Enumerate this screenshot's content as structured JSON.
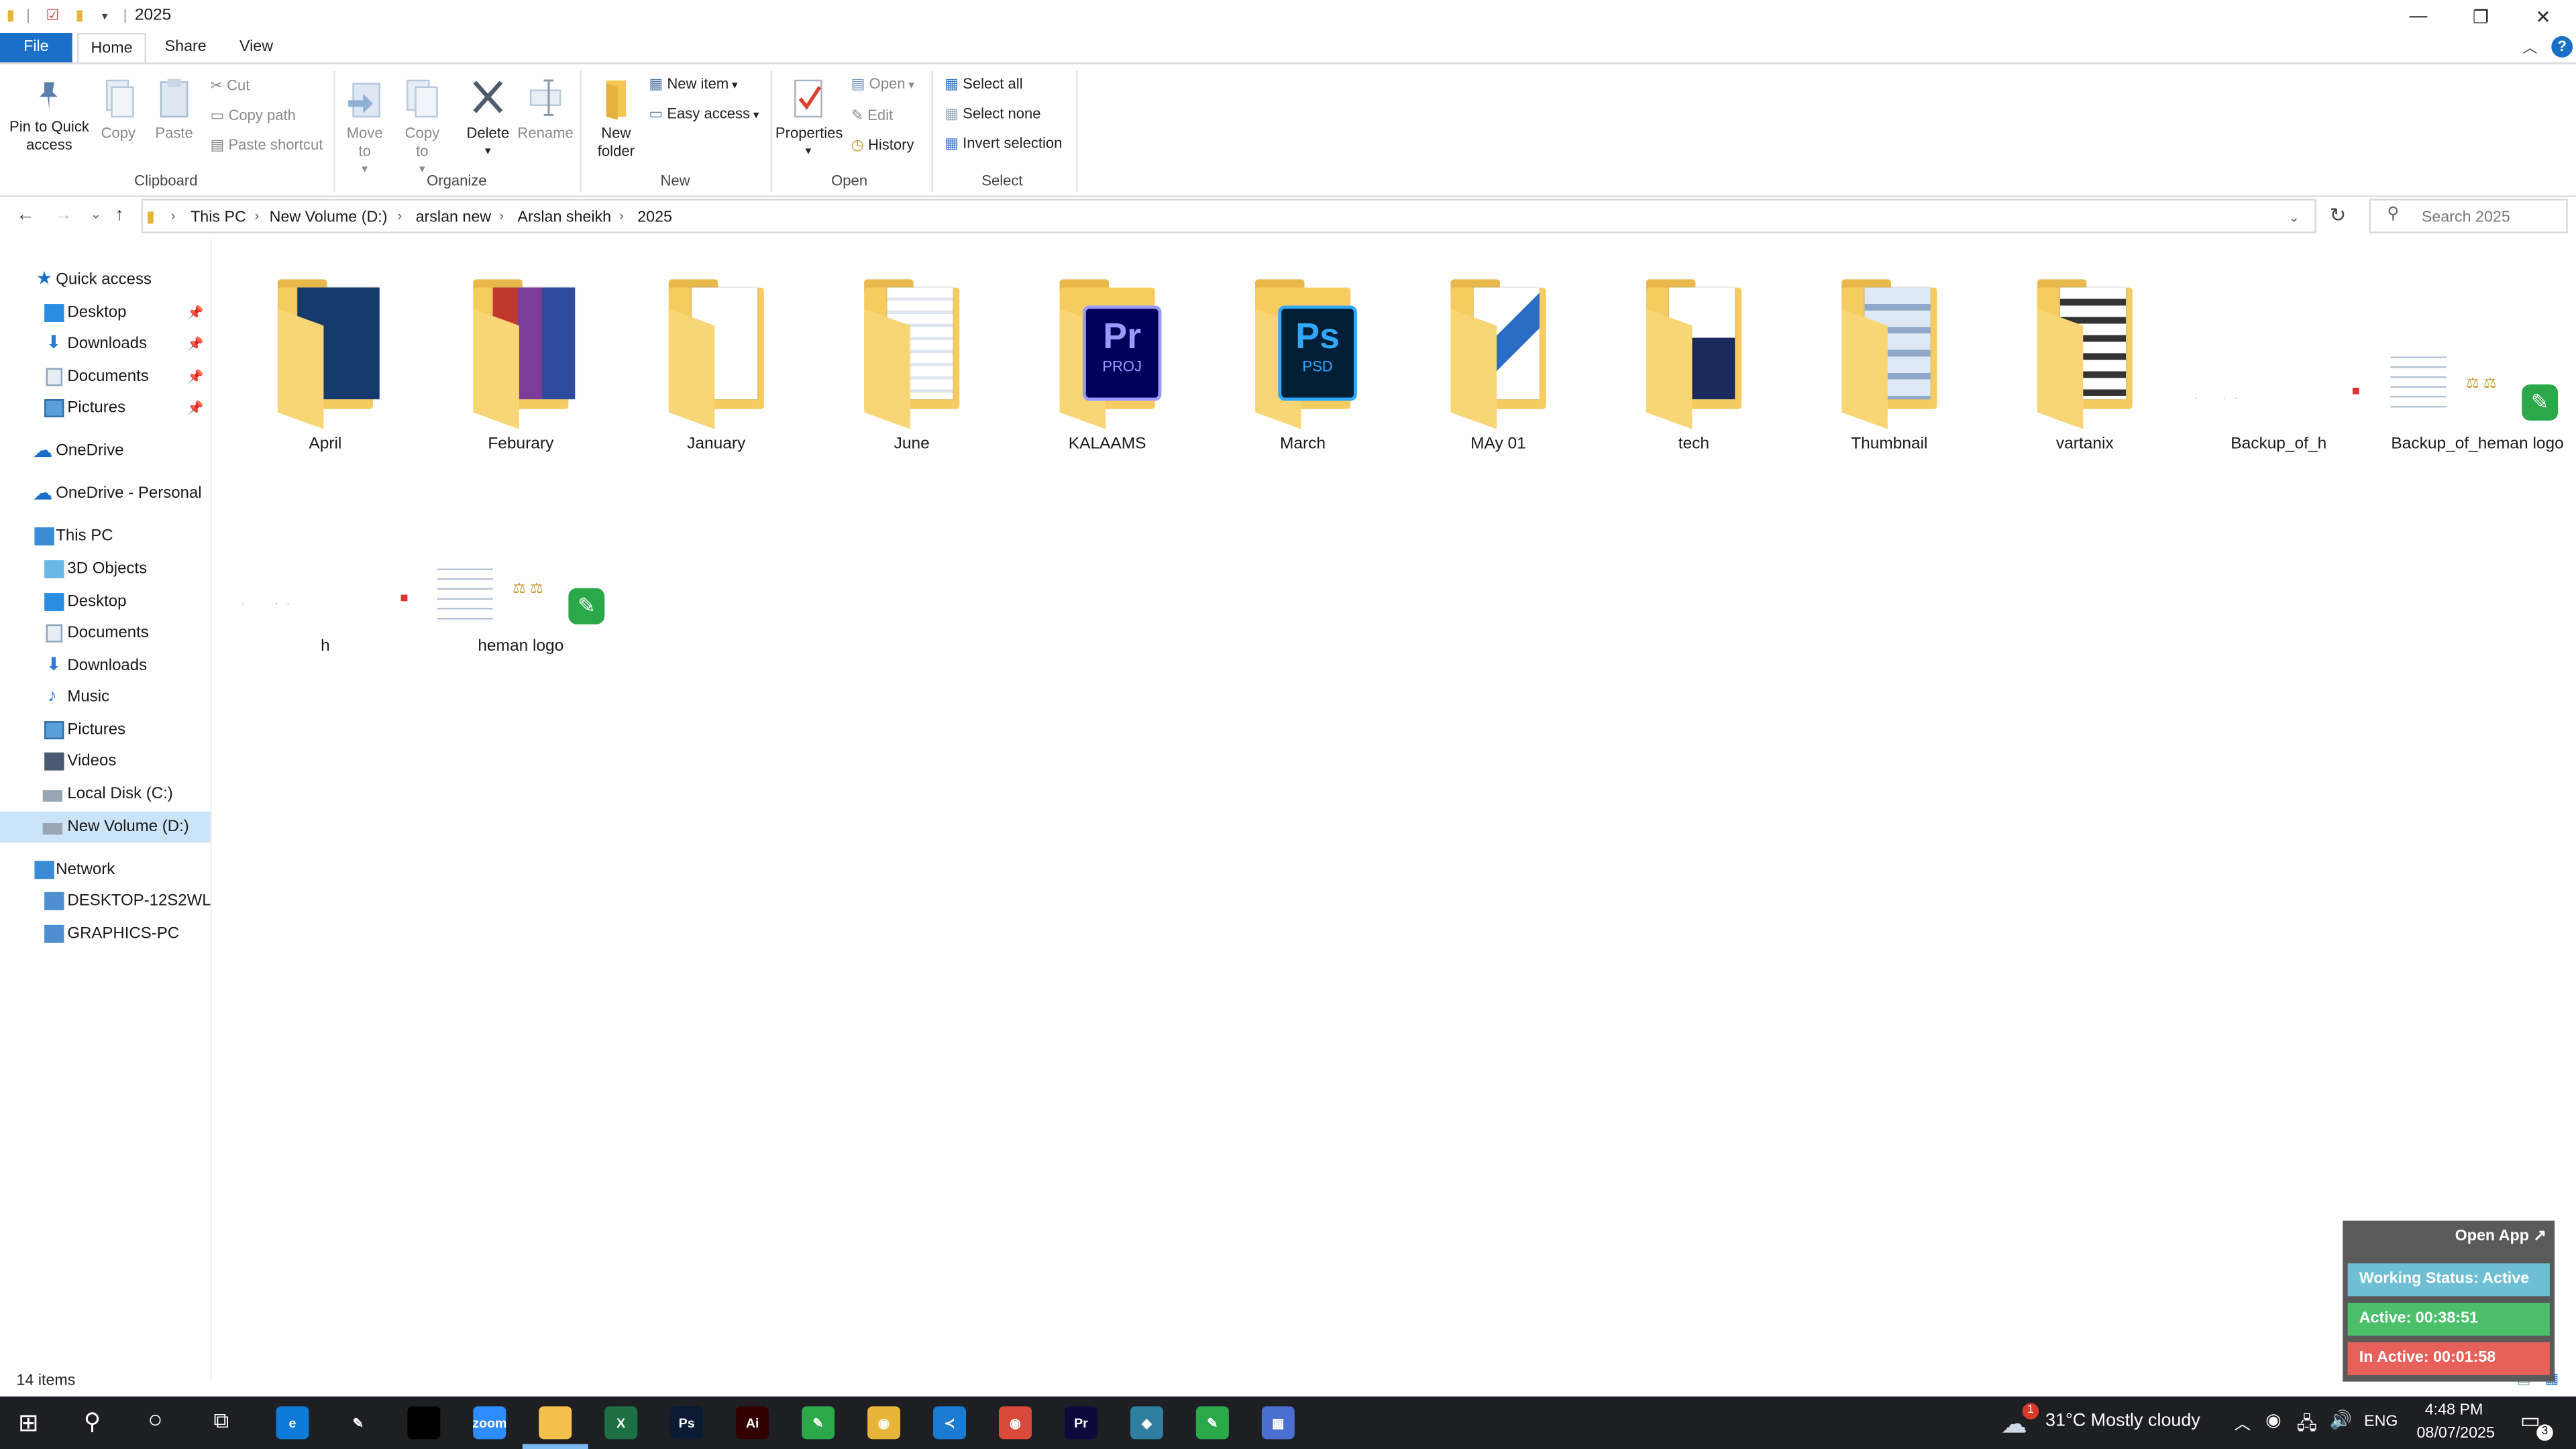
{
  "window": {
    "title": "2025",
    "minimize": "—",
    "restore": "❐",
    "close": "✕",
    "help": "?"
  },
  "tabs": [
    "File",
    "Home",
    "Share",
    "View"
  ],
  "ribbon": {
    "clipboard": {
      "pin_label": "Pin to Quick access",
      "copy_label": "Copy",
      "paste_label": "Paste",
      "cut_label": "Cut",
      "copy_path_label": "Copy path",
      "paste_shortcut_label": "Paste shortcut",
      "group_label": "Clipboard"
    },
    "organize": {
      "move_to_label": "Move to",
      "copy_to_label": "Copy to",
      "delete_label": "Delete",
      "rename_label": "Rename",
      "group_label": "Organize"
    },
    "new": {
      "new_folder_label": "New folder",
      "new_item_label": "New item",
      "easy_access_label": "Easy access",
      "group_label": "New"
    },
    "open": {
      "properties_label": "Properties",
      "open_label": "Open",
      "edit_label": "Edit",
      "history_label": "History",
      "group_label": "Open"
    },
    "select": {
      "select_all_label": "Select all",
      "select_none_label": "Select none",
      "invert_selection_label": "Invert selection",
      "group_label": "Select"
    }
  },
  "address": {
    "crumbs": [
      "This PC",
      "New Volume (D:)",
      "arslan new",
      "Arslan sheikh",
      "2025"
    ],
    "search_placeholder": "Search 2025"
  },
  "nav": {
    "quick_access": "Quick access",
    "quick_items": [
      "Desktop",
      "Downloads",
      "Documents",
      "Pictures"
    ],
    "onedrive": "OneDrive",
    "onedrive_personal": "OneDrive - Personal",
    "this_pc": "This PC",
    "pc_items": [
      "3D Objects",
      "Desktop",
      "Documents",
      "Downloads",
      "Music",
      "Pictures",
      "Videos",
      "Local Disk (C:)",
      "New Volume (D:)"
    ],
    "network": "Network",
    "network_items": [
      "DESKTOP-12S2WL",
      "GRAPHICS-PC"
    ]
  },
  "items": [
    {
      "name": "April",
      "type": "folder"
    },
    {
      "name": "Feburary",
      "type": "folder"
    },
    {
      "name": "January",
      "type": "folder"
    },
    {
      "name": "June",
      "type": "folder"
    },
    {
      "name": "KALAAMS",
      "type": "folder",
      "badge": "PROJ",
      "badge_letters": "Pr"
    },
    {
      "name": "March",
      "type": "folder",
      "badge": "PSD",
      "badge_letters": "Ps"
    },
    {
      "name": "MAy 01",
      "type": "folder"
    },
    {
      "name": "tech",
      "type": "folder"
    },
    {
      "name": "Thumbnail",
      "type": "folder"
    },
    {
      "name": "vartanix",
      "type": "folder"
    },
    {
      "name": "Backup_of_h",
      "type": "file"
    },
    {
      "name": "Backup_of_heman logo",
      "type": "file"
    },
    {
      "name": "h",
      "type": "file"
    },
    {
      "name": "heman logo",
      "type": "file"
    }
  ],
  "status": {
    "item_count": "14 items"
  },
  "widget": {
    "open_app": "Open App ↗",
    "working_status": "Working Status: Active",
    "active": "Active: 00:38:51",
    "inactive": "In Active: 00:01:58"
  },
  "taskbar": {
    "weather": "31°C  Mostly cloudy",
    "weather_badge": "1",
    "language": "ENG",
    "time": "4:48 PM",
    "date": "08/07/2025",
    "notification_count": "3",
    "apps": [
      {
        "icon": "edge-icon",
        "color": "#0f7ad8",
        "text": "e"
      },
      {
        "icon": "pen-icon",
        "color": "#1e1f23",
        "text": "✎"
      },
      {
        "icon": "terminal-icon",
        "color": "#000000",
        "text": ""
      },
      {
        "icon": "zoom-icon",
        "color": "#2d8cff",
        "text": "zoom"
      },
      {
        "icon": "file-explorer-icon",
        "color": "#f3c14b",
        "text": ""
      },
      {
        "icon": "excel-icon",
        "color": "#1d7044",
        "text": "X"
      },
      {
        "icon": "photoshop-icon",
        "color": "#0a1b33",
        "text": "Ps"
      },
      {
        "icon": "illustrator-icon",
        "color": "#330000",
        "text": "Ai"
      },
      {
        "icon": "corel-icon",
        "color": "#2aa84a",
        "text": "✎"
      },
      {
        "icon": "chrome-icon",
        "color": "#e9b43a",
        "text": "◉"
      },
      {
        "icon": "vscode-icon",
        "color": "#1a7bd2",
        "text": "≺"
      },
      {
        "icon": "chrome-icon-2",
        "color": "#d94a3a",
        "text": "◉"
      },
      {
        "icon": "premiere-icon",
        "color": "#0a0a3d",
        "text": "Pr"
      },
      {
        "icon": "app-icon",
        "color": "#2f7fa0",
        "text": "◆"
      },
      {
        "icon": "corel-icon-2",
        "color": "#2aa84a",
        "text": "✎"
      },
      {
        "icon": "calculator-icon",
        "color": "#4a6fd0",
        "text": "▦"
      }
    ]
  }
}
